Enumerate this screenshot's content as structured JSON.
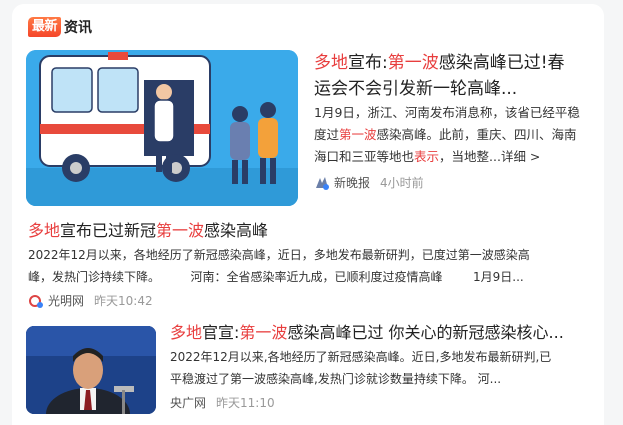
{
  "header": {
    "badge": "最新",
    "label": "资讯"
  },
  "items": [
    {
      "title_parts": [
        "多地",
        "宣布:",
        "第一波",
        "感染高峰已过!春",
        "运会不会引发新一轮高峰..."
      ],
      "summary_parts": [
        "1月9日，浙江、河南发布消息称，该省已经平稳度过",
        "第一波",
        "感染高峰。此前，重庆、四川、海南海口和三亚等地也",
        "表示",
        "，当地整..."
      ],
      "more_label": "详细 >",
      "source": "新晚报",
      "time": "4小时前"
    },
    {
      "title_parts": [
        "多地",
        "宣布已过新冠",
        "第一波",
        "感染高峰"
      ],
      "summary_line1": "2022年12月以来，各地经历了新冠感染高峰，近日，多地发布最新研判，已度过第一波感染高",
      "summary_line2": "峰，发热门诊持续下降。        河南：全省感染率近九成，已顺利度过疫情高峰        1月9日...",
      "source": "光明网",
      "time": "昨天10:42"
    },
    {
      "title_parts": [
        "多地",
        "官宣:",
        "第一波",
        "感染高峰已过 你关心的新冠感染核心..."
      ],
      "summary_line1": "2022年12月以来,各地经历了新冠感染高峰。近日,多地发布最新研判,已",
      "summary_line2": "平稳渡过了第一波感染高峰,发热门诊就诊数量持续下降。 河...",
      "source": "央广网",
      "time": "昨天11:10"
    }
  ],
  "colors": {
    "highlight": "#e83e3e",
    "badge": "#f5462a"
  },
  "icons": {
    "news_src": "xinwanbao-icon",
    "gmw_src": "guangming-icon"
  }
}
